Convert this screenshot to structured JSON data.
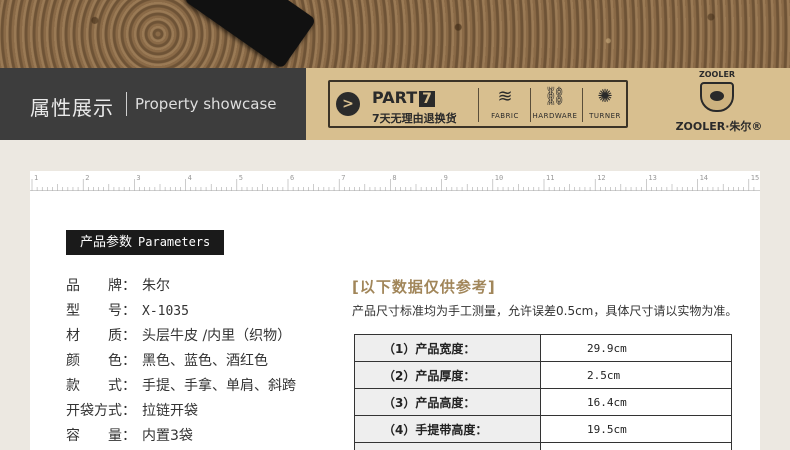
{
  "header": {
    "title_cn": "属性展示",
    "title_en": "Property showcase",
    "part_label": "PART",
    "part_number": "7",
    "part_sub": "7天无理由退换货",
    "features": [
      {
        "icon": "fabric-icon",
        "label": "FABRIC"
      },
      {
        "icon": "hardware-icon",
        "label": "HARDWARE"
      },
      {
        "icon": "turner-icon",
        "label": "TURNER"
      }
    ],
    "brand_top": "ZOOLER",
    "brand_bottom": "ZOOLER·朱尔",
    "brand_mark": "®"
  },
  "ruler": {
    "labels": [
      "1",
      "2",
      "3",
      "4",
      "5",
      "6",
      "7",
      "8",
      "9",
      "10",
      "11",
      "12",
      "13",
      "14",
      "15"
    ]
  },
  "params": {
    "title_cn": "产品参数",
    "title_en": "Parameters",
    "rows": [
      {
        "key": "品　　牌：",
        "value": "朱尔"
      },
      {
        "key": "型　　号：",
        "value": "X-1035"
      },
      {
        "key": "材　　质：",
        "value": "头层牛皮 /内里（织物）"
      },
      {
        "key": "颜　　色：",
        "value": "黑色、蓝色、酒红色"
      },
      {
        "key": "款　　式：",
        "value": "手提、手拿、单肩、斜跨"
      },
      {
        "key": "开袋方式：",
        "value": "拉链开袋"
      },
      {
        "key": "容　　量：",
        "value": "内置3袋"
      }
    ]
  },
  "reference": {
    "title": "[以下数据仅供参考]",
    "note": "产品尺寸标准均为手工测量，允许误差0.5cm，具体尺寸请以实物为准。",
    "table": [
      {
        "key": "（1）产品宽度：",
        "value": "29.9cm"
      },
      {
        "key": "（2）产品厚度：",
        "value": "2.5cm"
      },
      {
        "key": "（3）产品高度：",
        "value": "16.4cm"
      },
      {
        "key": "（4）手提带高度：",
        "value": "19.5cm"
      },
      {
        "key": "",
        "value": ""
      }
    ]
  },
  "colors": {
    "header_dark": "#3d3d3d",
    "header_tan": "#d8bf8f",
    "reference_title": "#a1865a"
  }
}
